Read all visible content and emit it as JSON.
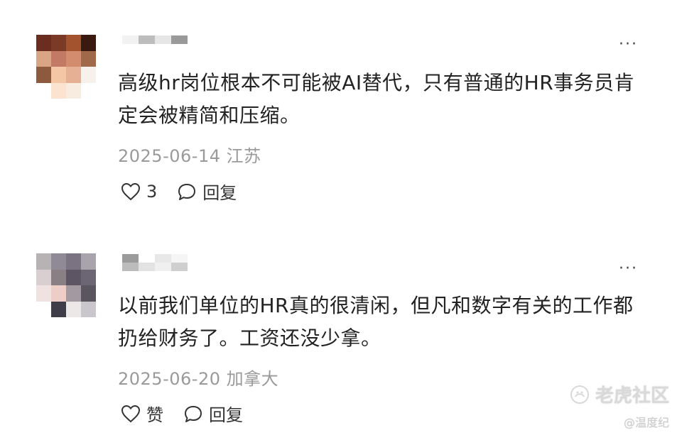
{
  "comments": [
    {
      "content": "高级hr岗位根本不可能被AI替代，只有普通的HR事务员肯定会被精简和压缩。",
      "date": "2025-06-14",
      "location": "江苏",
      "like_label": "3",
      "reply_label": "回复",
      "more_label": "···",
      "avatar_pixels": [
        "#6b2d1f",
        "#7a3a26",
        "#a3542f",
        "#3a1a10",
        "#d9a585",
        "#c27a64",
        "#d48c6f",
        "#a06a4a",
        "#8e5a3e",
        "#f4c6a6",
        "#e5b093",
        "#f8f0ea",
        "#ffffff",
        "#fce3cf",
        "#f7ecdf",
        "#ffffff"
      ],
      "username_pixels": [
        "#f2f2f2",
        "#bdbdbd",
        "#e6e6e6",
        "#9a9a9a",
        "#ffffff",
        "#ffffff",
        "#ffffff",
        "#ffffff"
      ]
    },
    {
      "content": "以前我们单位的HR真的很清闲，但凡和数字有关的工作都扔给财务了。工资还没少拿。",
      "date": "2025-06-20",
      "location": "加拿大",
      "like_label": "赞",
      "reply_label": "回复",
      "more_label": "···",
      "avatar_pixels": [
        "#b7b3b4",
        "#8f8a96",
        "#7b7382",
        "#a9a4ab",
        "#d9cfd0",
        "#8b7f86",
        "#5e5564",
        "#6c6573",
        "#f0e2e0",
        "#eccdc8",
        "#a29aa0",
        "#5a5660",
        "#ffffff",
        "#3f3d47",
        "#ece8e8",
        "#c9c7cc"
      ],
      "username_pixels": [
        "#9b9b9b",
        "#ffffff",
        "#e8e8e8",
        "#f5f5f5",
        "#bcbcbc",
        "#e3e3e3",
        "#f0f0f0",
        "#cfcfcf"
      ]
    }
  ],
  "watermark": {
    "brand": "老虎社区",
    "sub": "@温度纪"
  }
}
